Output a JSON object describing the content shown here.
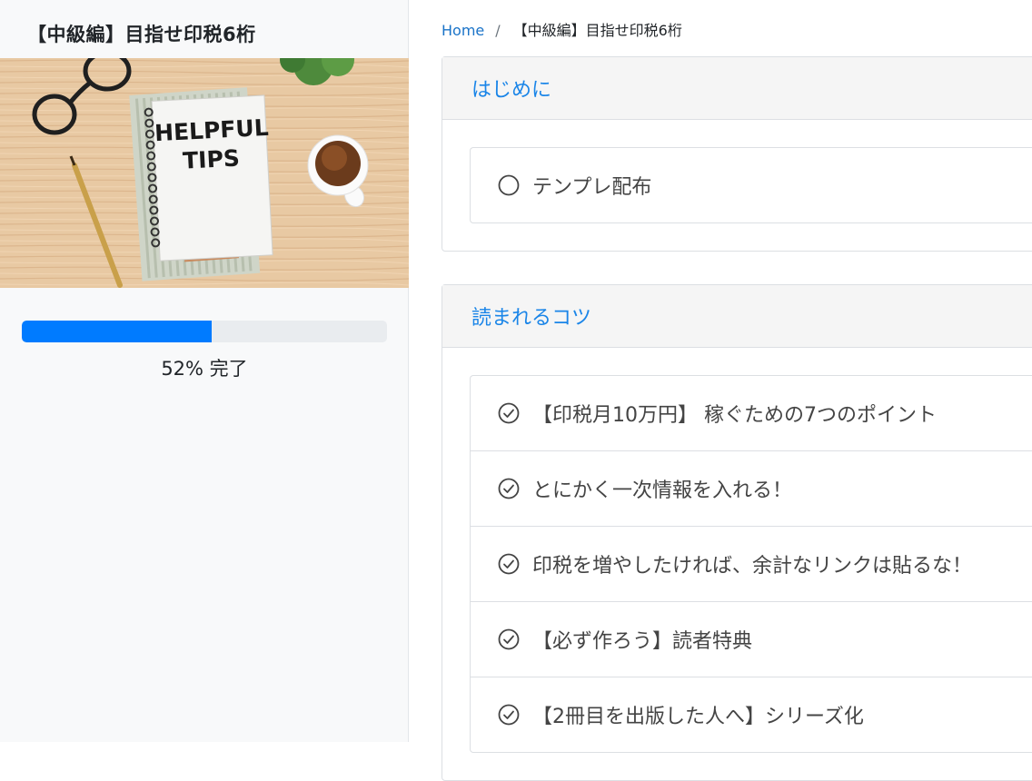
{
  "course": {
    "title": "【中級編】目指せ印税6桁",
    "image_text_line1": "HELPFUL",
    "image_text_line2": "TIPS",
    "progress_percent": 52,
    "progress_label": "52% 完了"
  },
  "breadcrumb": {
    "home": "Home",
    "separator": "/",
    "current": "【中級編】目指せ印税6桁"
  },
  "sections": [
    {
      "title": "はじめに",
      "lessons": [
        {
          "label": "テンプレ配布",
          "icon": "circle-icon",
          "completed": false
        }
      ]
    },
    {
      "title": "読まれるコツ",
      "lessons": [
        {
          "label": "【印税月10万円】 稼ぐための7つのポイント",
          "icon": "check-circle-icon",
          "completed": true
        },
        {
          "label": "とにかく一次情報を入れる！",
          "icon": "check-circle-icon",
          "completed": true
        },
        {
          "label": "印税を増やしたければ、余計なリンクは貼るな！",
          "icon": "check-circle-icon",
          "completed": true
        },
        {
          "label": "【必ず作ろう】読者特典",
          "icon": "check-circle-icon",
          "completed": true
        },
        {
          "label": "【2冊目を出版した人へ】シリーズ化",
          "icon": "check-circle-icon",
          "completed": true
        }
      ]
    }
  ],
  "colors": {
    "accent": "#007bff",
    "section_title": "#1a85e8",
    "link": "#1a73c8"
  }
}
